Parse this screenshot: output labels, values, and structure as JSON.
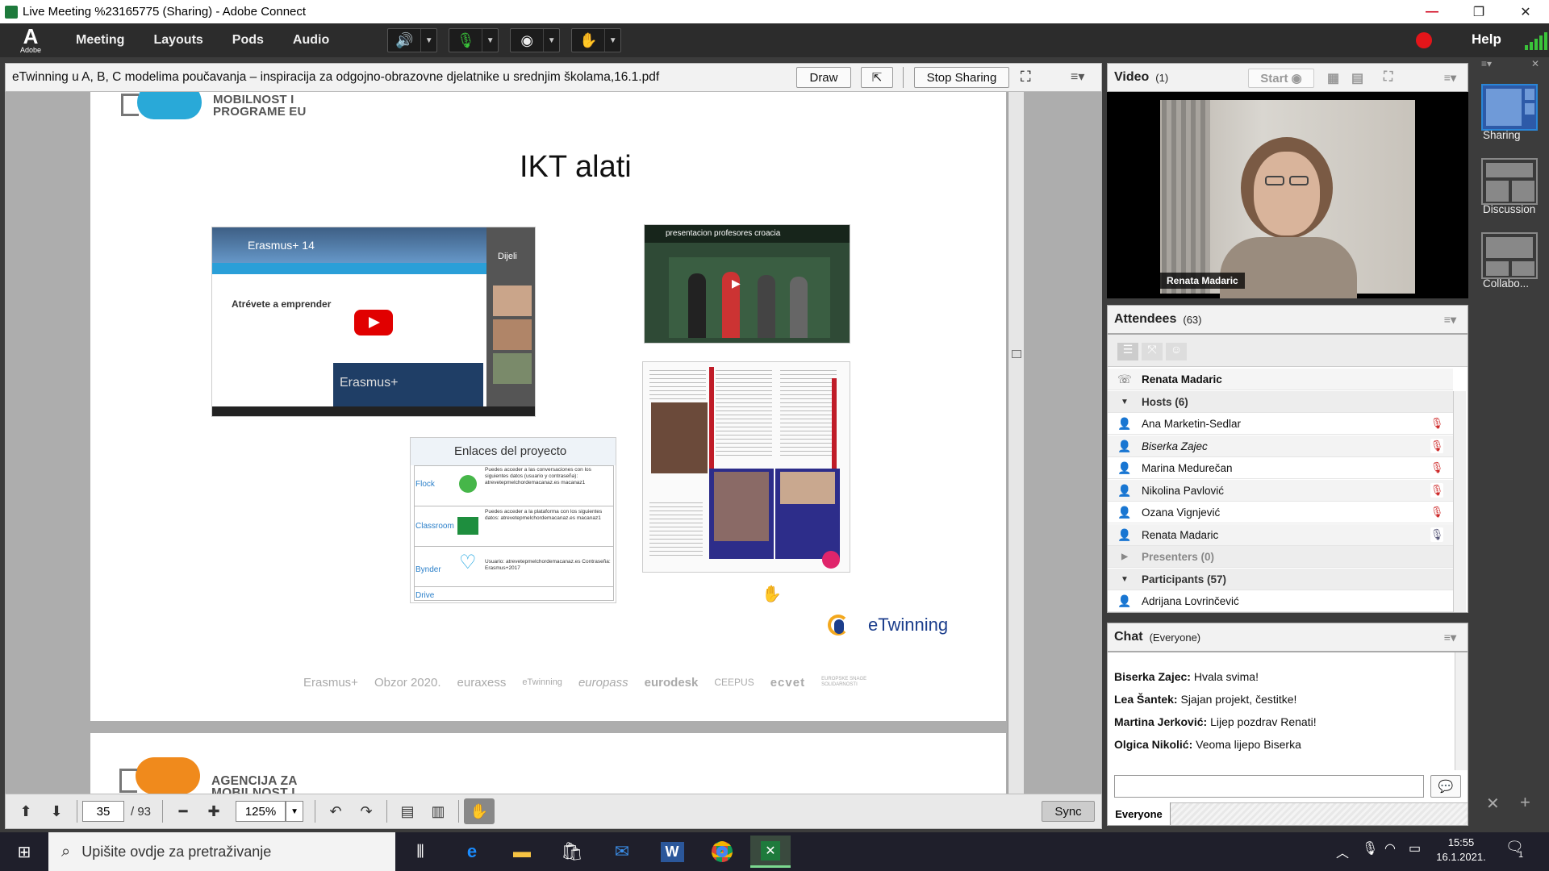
{
  "window": {
    "title": "Live Meeting %23165775 (Sharing) - Adobe Connect"
  },
  "menubar": {
    "logo_text": "Adobe",
    "items": [
      "Meeting",
      "Layouts",
      "Pods",
      "Audio"
    ],
    "help_label": "Help"
  },
  "share_pod": {
    "document_title": "eTwinning u A, B, C modelima poučavanja – inspiracija za odgojno-obrazovne djelatnike u srednjim školama,16.1.pdf",
    "draw_label": "Draw",
    "stop_sharing_label": "Stop Sharing",
    "current_page": "35",
    "total_pages": "/ 93",
    "zoom": "125%",
    "sync_label": "Sync"
  },
  "slide": {
    "logo_line1": "MOBILNOST I",
    "logo_line2": "PROGRAME EU",
    "title": "IKT alati",
    "video_title": "Erasmus+ 14",
    "video_share": "Dijeli",
    "video_page_heading": "Atrévete a emprender",
    "video_caption": "Erasmus+",
    "video2_title": "presentacion profesores croacia",
    "enlaces_title": "Enlaces del proyecto",
    "enlaces_rows": [
      {
        "name": "Flock",
        "text": "Puedes acceder a las conversaciones con los siguientes datos (usuario y contraseña): atrevetepmelchordemacanaz.es macanaz1"
      },
      {
        "name": "Classroom",
        "text": "Puedes acceder a la plataforma con los siguientes datos: atrevetepmelchordemacanaz.es macanaz1"
      },
      {
        "name": "Bynder",
        "text": "Usuario: atrevetepmelchordemacanaz.es Contraseña: Erasmus+2017"
      },
      {
        "name": "Drive",
        "text": ""
      }
    ],
    "etwinning_label": "eTwinning",
    "footer_logos": [
      "Erasmus+",
      "Obzor 2020.",
      "euraxess",
      "eTwinning",
      "europass",
      "eurodesk",
      "CEEPUS",
      "ecvet",
      "EUROPSKE SNAGE SOLIDARNOSTI"
    ],
    "page2_logo_line1": "AGENCIJA ZA",
    "page2_logo_line2": "MOBILNOST I"
  },
  "video_pod": {
    "title": "Video",
    "count": "(1)",
    "start_label": "Start",
    "presenter_name": "Renata Madaric"
  },
  "attendees_pod": {
    "title": "Attendees",
    "count": "(63)",
    "current_user": "Renata Madaric",
    "hosts_label": "Hosts (6)",
    "hosts": [
      "Ana Marketin-Sedlar",
      "Biserka Zajec",
      "Marina Medurečan",
      "Nikolina Pavlović",
      "Ozana Vignjević",
      "Renata Madaric"
    ],
    "presenters_label": "Presenters (0)",
    "participants_label": "Participants (57)",
    "participants": [
      "Adrijana Lovrinčević"
    ]
  },
  "chat_pod": {
    "title": "Chat",
    "scope": "(Everyone)",
    "messages": [
      {
        "sender": "Biserka Zajec:",
        "text": "Hvala svima!"
      },
      {
        "sender": "Lea Šantek:",
        "text": "Sjajan projekt, čestitke!"
      },
      {
        "sender": "Martina Jerković:",
        "text": "Lijep pozdrav Renati!"
      },
      {
        "sender": "Olgica Nikolić:",
        "text": "Veoma lijepo Biserka"
      }
    ],
    "input_placeholder": "",
    "recipient_tab": "Everyone"
  },
  "layouts": [
    "Sharing",
    "Discussion",
    "Collabo..."
  ],
  "taskbar": {
    "search_placeholder": "Upišite ovdje za pretraživanje",
    "time": "15:55",
    "date": "16.1.2021.",
    "notification_count": "1"
  },
  "colors": {
    "menubar_bg": "#2c2c2c",
    "record_red": "#e3151a",
    "audio_green": "#3ac43a",
    "taskbar_bg": "#1f1f2b"
  }
}
